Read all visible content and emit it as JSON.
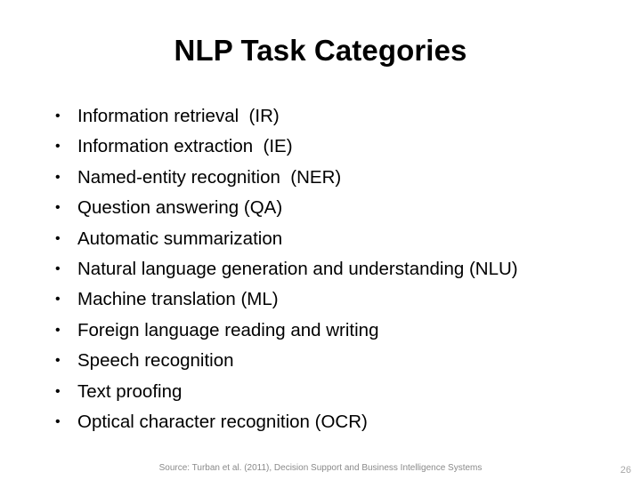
{
  "slide": {
    "title": "NLP Task Categories",
    "bullet_marker": "•",
    "bullets": [
      {
        "text": "Information retrieval  (IR)"
      },
      {
        "text": "Information extraction  (IE)"
      },
      {
        "text": "Named-entity recognition  (NER)"
      },
      {
        "text": "Question answering (QA)"
      },
      {
        "text": "Automatic summarization"
      },
      {
        "text": "Natural language generation and understanding (NLU)"
      },
      {
        "text": "Machine translation (ML)"
      },
      {
        "text": "Foreign language reading and writing"
      },
      {
        "text": "Speech recognition"
      },
      {
        "text": "Text proofing"
      },
      {
        "text": "Optical character recognition (OCR)"
      }
    ],
    "footer": {
      "source": "Source: Turban et al. (2011), Decision Support and Business Intelligence Systems",
      "page_number": "26"
    },
    "colors": {
      "background": "#ffffff",
      "text": "#000000",
      "source_text": "#8a8a8a",
      "page_number_text": "#a6a6a6"
    }
  }
}
